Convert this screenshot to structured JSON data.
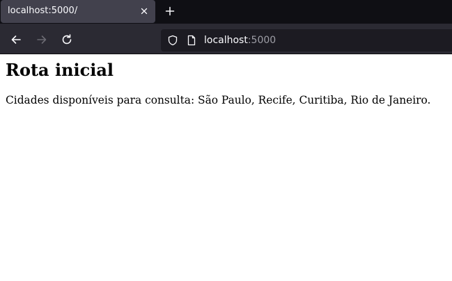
{
  "browser": {
    "tab": {
      "title": "localhost:5000/",
      "close_icon": "close-icon"
    },
    "new_tab_icon": "plus-icon",
    "nav": {
      "back_icon": "arrow-left-icon",
      "forward_icon": "arrow-right-icon",
      "reload_icon": "reload-icon"
    },
    "urlbar": {
      "shield_icon": "shield-icon",
      "page_icon": "page-icon",
      "host": "localhost",
      "port": ":5000"
    },
    "colors": {
      "tabstrip": "#0f0f14",
      "active_tab": "#42414d",
      "toolbar": "#2b2a33",
      "urlbar": "#1c1b22",
      "text": "#fbfbfe",
      "muted": "#9e9ea6"
    }
  },
  "page": {
    "heading": "Rota inicial",
    "paragraph": "Cidades disponíveis para consulta: São Paulo, Recife, Curitiba, Rio de Janeiro."
  }
}
